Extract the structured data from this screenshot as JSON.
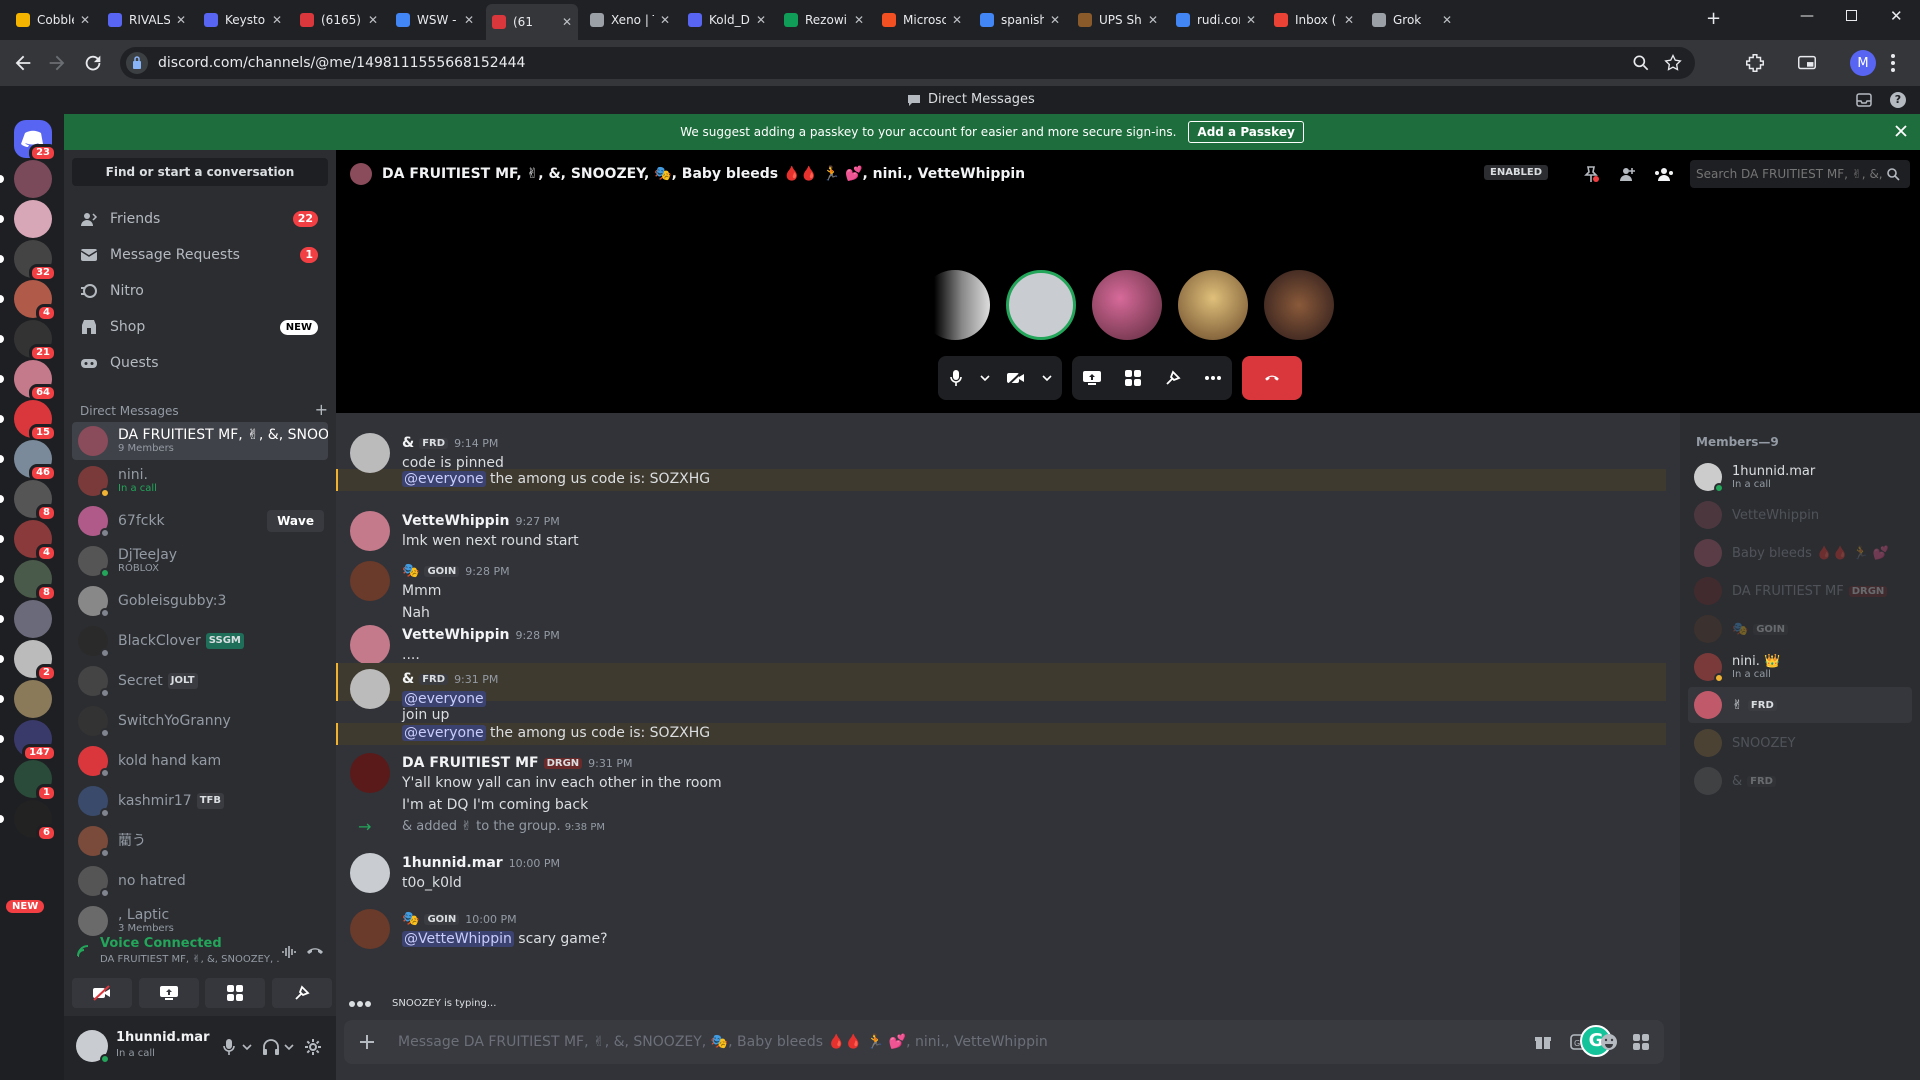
{
  "browser": {
    "tabs": [
      {
        "title": "Cobble",
        "color": "#f4b400"
      },
      {
        "title": "RIVALS",
        "color": "#5865f2"
      },
      {
        "title": "Keyston",
        "color": "#5865f2"
      },
      {
        "title": "(6165) I",
        "color": "#da373c"
      },
      {
        "title": "WSW -",
        "color": "#4285f4"
      },
      {
        "title": "(61",
        "color": "#da373c"
      },
      {
        "title": "Xeno | T",
        "color": "#9aa0a6"
      },
      {
        "title": "Kold_D",
        "color": "#5865f2"
      },
      {
        "title": "Rezowi",
        "color": "#0f9d58"
      },
      {
        "title": "Microsc",
        "color": "#f25022"
      },
      {
        "title": "spanish",
        "color": "#4285f4"
      },
      {
        "title": "UPS Sh",
        "color": "#8b5a2b"
      },
      {
        "title": "rudi.cor",
        "color": "#4285f4"
      },
      {
        "title": "Inbox (",
        "color": "#ea4335"
      },
      {
        "title": "Grok",
        "color": "#9aa0a6"
      }
    ],
    "url": "discord.com/channels/@me/1498111555668152444",
    "profile_initial": "M"
  },
  "discord": {
    "top_title": "Direct Messages",
    "banner": {
      "text": "We suggest adding a passkey to your account for easier and more secure sign-ins.",
      "button": "Add a Passkey"
    },
    "rail_badges": [
      "23",
      "",
      "",
      "32",
      "4",
      "21",
      "64",
      "15",
      "46",
      "8",
      "4",
      "8",
      "",
      "2",
      "",
      "147",
      "1",
      "6"
    ],
    "rail_new": "NEW",
    "sidebar": {
      "find": "Find or start a conversation",
      "nav": [
        {
          "label": "Friends",
          "badge": "22"
        },
        {
          "label": "Message Requests",
          "badge": "1"
        },
        {
          "label": "Nitro",
          "badge": ""
        },
        {
          "label": "Shop",
          "badge": "NEW"
        },
        {
          "label": "Quests",
          "badge": ""
        }
      ],
      "dm_header": "Direct Messages",
      "dms": [
        {
          "name": "DA FRUITIEST MF, ✌︎, &, SNOOZ...",
          "sub": "9 Members",
          "tag": "",
          "color": "#8a4b5a"
        },
        {
          "name": "nini.",
          "sub": "In a call",
          "tag": "",
          "color": "#7a3a3a"
        },
        {
          "name": "67fckk",
          "sub": "",
          "tag": "",
          "color": "#b05a8a",
          "wave": "Wave"
        },
        {
          "name": "DjTeeJay",
          "sub": "ROBLOX",
          "tag": "",
          "color": "#555"
        },
        {
          "name": "Gobleisgubby:3",
          "sub": "",
          "tag": "",
          "color": "#888"
        },
        {
          "name": "BlackClover",
          "sub": "",
          "tag": "SSGM",
          "color": "#2a2a2a"
        },
        {
          "name": "Secret",
          "sub": "",
          "tag": "JOLT",
          "color": "#444"
        },
        {
          "name": "SwitchYoGranny",
          "sub": "",
          "tag": "",
          "color": "#333"
        },
        {
          "name": "kold hand kam",
          "sub": "",
          "tag": "",
          "color": "#da373c"
        },
        {
          "name": "kashmir17",
          "sub": "",
          "tag": "TFB",
          "color": "#3a4a6a"
        },
        {
          "name": "藺う",
          "sub": "",
          "tag": "",
          "color": "#7a4a3a"
        },
        {
          "name": "no hatred",
          "sub": "",
          "tag": "",
          "color": "#555"
        },
        {
          "name": ", Laptic",
          "sub": "3 Members",
          "tag": "",
          "color": "#6a6a6a"
        }
      ],
      "voice": {
        "title": "Voice Connected",
        "channel": "DA FRUITIEST MF, ✌︎, &, SNOOZEY, ..."
      },
      "user": {
        "name": "1hunnid.mar",
        "status": "In a call"
      }
    },
    "channel": {
      "title": "DA FRUITIEST MF, ✌︎, &, SNOOZEY, 🎭, Baby bleeds 🩸🩸 🏃 💕, nini., VetteWhippin",
      "enabled": "ENABLED",
      "search_placeholder": "Search DA FRUITIEST MF, ✌︎, &, S..."
    },
    "messages": [
      {
        "author": "&",
        "tag": "FRD",
        "time": "9:14 PM",
        "lines": [
          "code is pinned"
        ],
        "hl_mention": "@everyone",
        "hl_text": " the among us code is: SOZXHG"
      },
      {
        "author": "VetteWhippin",
        "tag": "",
        "time": "9:27 PM",
        "lines": [
          "lmk wen next round start"
        ]
      },
      {
        "author": "🎭",
        "tag": "GOIN",
        "time": "9:28 PM",
        "lines": [
          "Mmm",
          "Nah"
        ]
      },
      {
        "author": "VetteWhippin",
        "tag": "",
        "time": "9:28 PM",
        "lines": [
          "...."
        ]
      },
      {
        "author": "&",
        "tag": "FRD",
        "time": "9:31 PM",
        "m1": "@everyone",
        "line2": "join up",
        "hl_mention": "@everyone",
        "hl_text": " the among us code is: SOZXHG"
      },
      {
        "author": "DA FRUITIEST MF",
        "tag": "DRGN",
        "time": "9:31 PM",
        "lines": [
          "Y'all know yall can inv each other in the room",
          "I'm at DQ I'm coming back"
        ]
      },
      {
        "system": "& added ✌︎ to the group.",
        "time": "9:38 PM"
      },
      {
        "author": "1hunnid.mar",
        "tag": "",
        "time": "10:00 PM",
        "lines": [
          "t0o_k0ld"
        ]
      },
      {
        "author": "🎭",
        "tag": "GOIN",
        "time": "10:00 PM",
        "mention": "@VetteWhippin",
        "text": " scary game?"
      }
    ],
    "typing": "SNOOZEY is typing...",
    "composer_placeholder": "Message DA FRUITIEST MF, ✌︎, &, SNOOZEY, 🎭, Baby bleeds 🩸🩸 🏃 💕, nini., VetteWhippin",
    "members_header": "Members—9",
    "members": [
      {
        "name": "1hunnid.mar",
        "sub": "In a call",
        "dim": false,
        "color": "#ccc"
      },
      {
        "name": "VetteWhippin",
        "sub": "",
        "dim": true,
        "color": "#8a4b5a"
      },
      {
        "name": "Baby bleeds 🩸🩸 🏃 💕",
        "sub": "",
        "dim": true,
        "color": "#b05a6a"
      },
      {
        "name": "DA FRUITIEST MF",
        "sub": "",
        "dim": true,
        "tag": "DRGN",
        "color": "#6a2a2a"
      },
      {
        "name": "🎭",
        "sub": "",
        "dim": true,
        "tag": "GOIN",
        "color": "#5a3a2a"
      },
      {
        "name": "nini. 👑",
        "sub": "In a call",
        "dim": false,
        "color": "#7a3a3a"
      },
      {
        "name": "✌︎",
        "sub": "",
        "dim": false,
        "tag": "FRD",
        "sel": true,
        "color": "#c05a6a"
      },
      {
        "name": "SNOOZEY",
        "sub": "",
        "dim": true,
        "color": "#8a6a3a"
      },
      {
        "name": "&",
        "sub": "",
        "dim": true,
        "tag": "FRD",
        "color": "#666"
      }
    ]
  }
}
